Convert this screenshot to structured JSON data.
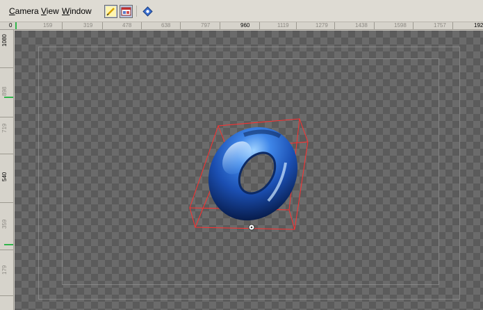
{
  "menubar": {
    "items": [
      {
        "pre": "",
        "ul": "C",
        "post": "amera"
      },
      {
        "pre": "",
        "ul": "V",
        "post": "iew"
      },
      {
        "pre": "",
        "ul": "W",
        "post": "indow"
      }
    ],
    "toolbar_icons": [
      "pencil-edit-icon",
      "render-window-icon",
      "gizmo-icon"
    ]
  },
  "hruler": {
    "labels": [
      "0",
      "159",
      "319",
      "478",
      "638",
      "797",
      "960",
      "1119",
      "1279",
      "1438",
      "1598",
      "1757",
      "192"
    ],
    "highlight": "960"
  },
  "vruler": {
    "labels": [
      "1080",
      "898",
      "719",
      "540",
      "359",
      "179"
    ],
    "highlight": "540"
  },
  "viewport": {
    "object": "torus",
    "colors": {
      "object": "#2a62c8",
      "bounding_box": "#ff3030",
      "pivot": "#ffffff",
      "green_marker": "#2fb44a"
    }
  }
}
